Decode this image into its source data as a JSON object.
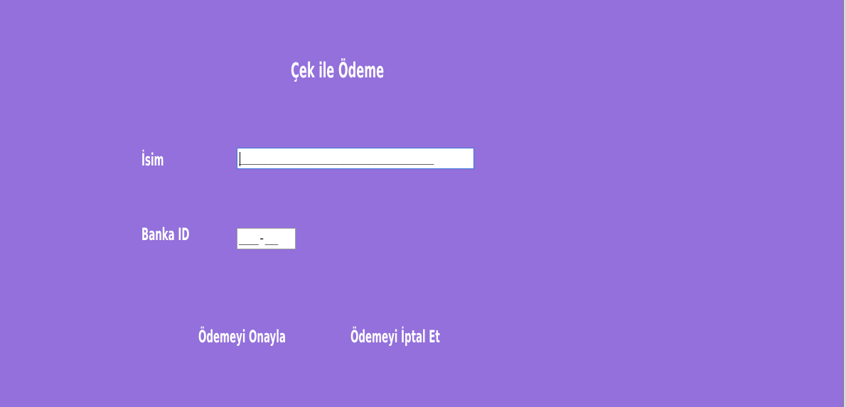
{
  "form": {
    "title": "Çek ile Ödeme",
    "name_label": "İsim",
    "bank_id_label": "Banka ID",
    "name_mask": "______________________________",
    "bank_id_mask": "___-__"
  },
  "actions": {
    "confirm_label": "Ödemeyi Onayla",
    "cancel_label": "Ödemeyi İptal Et"
  },
  "colors": {
    "background": "#9370DB",
    "text": "#FFFFFF",
    "input_background": "#FFFFFF",
    "focus_border": "#3B78D8"
  }
}
